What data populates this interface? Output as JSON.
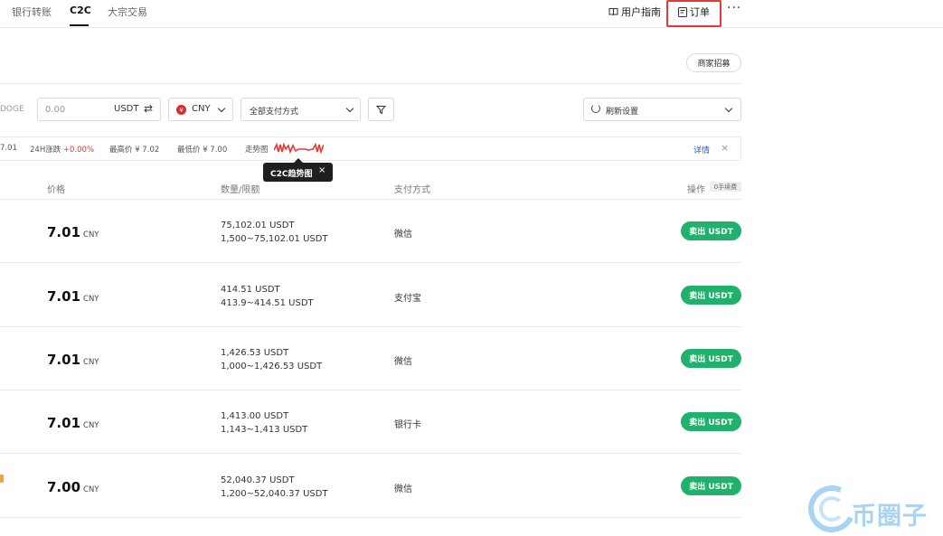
{
  "nav": {
    "tabs": [
      {
        "label": "银行转账",
        "active": false
      },
      {
        "label": "C2C",
        "active": true
      },
      {
        "label": "大宗交易",
        "active": false
      }
    ],
    "guide_label": "用户指南",
    "orders_label": "订单",
    "more_label": "···"
  },
  "merchant_button": "商家招募",
  "filters": {
    "coin_partial": "DOGE",
    "amount_placeholder": "0.00",
    "amount_currency": "USDT",
    "fiat": "CNY",
    "payment": "全部支付方式",
    "refresh": "刷新设置"
  },
  "stats": {
    "price_partial": "7.01",
    "change_label": "24H涨跌",
    "change_value": "+0.00%",
    "high": "最高价 ¥ 7.02",
    "low": "最低价 ¥ 7.00",
    "trend_label": "走势图",
    "details": "详情",
    "close": "×"
  },
  "tooltip": {
    "text": "C2C趋势图",
    "close": "×"
  },
  "table": {
    "headers": {
      "price": "价格",
      "quantity": "数量/限额",
      "payment": "支付方式",
      "action": "操作"
    },
    "fee_badge": "0手续费",
    "rows": [
      {
        "price": "7.01",
        "unit": "CNY",
        "qty": "75,102.01 USDT",
        "limit": "1,500~75,102.01 USDT",
        "payment": "微信",
        "action": "卖出 USDT"
      },
      {
        "price": "7.01",
        "unit": "CNY",
        "qty": "414.51 USDT",
        "limit": "413.9~414.51 USDT",
        "payment": "支付宝",
        "action": "卖出 USDT"
      },
      {
        "price": "7.01",
        "unit": "CNY",
        "qty": "1,426.53 USDT",
        "limit": "1,000~1,426.53 USDT",
        "payment": "微信",
        "action": "卖出 USDT"
      },
      {
        "price": "7.01",
        "unit": "CNY",
        "qty": "1,413.00 USDT",
        "limit": "1,143~1,413 USDT",
        "payment": "银行卡",
        "action": "卖出 USDT"
      },
      {
        "price": "7.00",
        "unit": "CNY",
        "qty": "52,040.37 USDT",
        "limit": "1,200~52,040.37 USDT",
        "payment": "微信",
        "action": "卖出 USDT"
      }
    ]
  },
  "watermark": "币圈子",
  "colors": {
    "buy_green": "#20b26c",
    "up_red": "#e53935",
    "highlight_red": "#e53935",
    "link_blue": "#1a5fd0"
  }
}
